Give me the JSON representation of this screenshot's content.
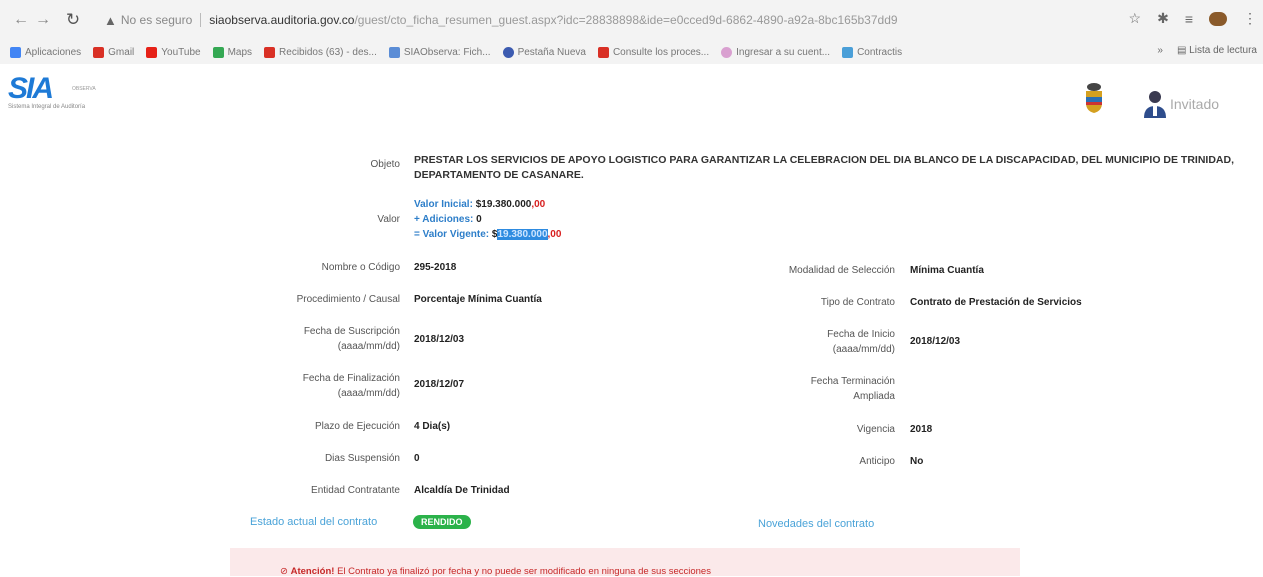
{
  "browser": {
    "secure_label": "No es seguro",
    "url_domain": "siaobserva.auditoria.gov.co",
    "url_path": "/guest/cto_ficha_resumen_guest.aspx?idc=28838898&ide=e0cced9d-6862-4890-a92a-8bc165b37dd9"
  },
  "bookmarks": [
    {
      "label": "Aplicaciones",
      "color": "#4285f4"
    },
    {
      "label": "Gmail",
      "color": "#d93025"
    },
    {
      "label": "YouTube",
      "color": "#e62117"
    },
    {
      "label": "Maps",
      "color": "#34a853"
    },
    {
      "label": "Recibidos (63) - des...",
      "color": "#d93025"
    },
    {
      "label": "SIAObserva: Fich...",
      "color": "#5b8dd6"
    },
    {
      "label": "Pestaña Nueva",
      "color": "#3c5bb0"
    },
    {
      "label": "Consulte los proces...",
      "color": "#d93025"
    },
    {
      "label": "Ingresar a su cuent...",
      "color": "#d9a0d0"
    },
    {
      "label": "Contractis",
      "color": "#4a9fd8"
    }
  ],
  "bookmarks_right": {
    "more": "»",
    "reading_list": "Lista de lectura"
  },
  "header": {
    "logo": "SIA",
    "logo_tag": "OBSERVA",
    "logo_sub": "Sistema Integral de Auditoría",
    "user_label": "Invitado"
  },
  "contract": {
    "objeto_label": "Objeto",
    "objeto": "PRESTAR LOS SERVICIOS DE APOYO LOGISTICO PARA GARANTIZAR LA CELEBRACION DEL DIA BLANCO DE LA DISCAPACIDAD, DEL MUNICIPIO DE TRINIDAD, DEPARTAMENTO DE CASANARE.",
    "valor_label": "Valor",
    "valor_inicial_label": "Valor Inicial:",
    "valor_inicial": "$19.380.000",
    "valor_inicial_cents": ",00",
    "adiciones_label": "+ Adiciones:",
    "adiciones": "0",
    "valor_vigente_label": "= Valor Vigente:",
    "valor_vigente_prefix": "$",
    "valor_vigente": "19.380.000",
    "valor_vigente_cents": ",00",
    "nombre_label": "Nombre o Código",
    "nombre": "295-2018",
    "modalidad_label": "Modalidad de Selección",
    "modalidad": "Mínima Cuantía",
    "procedimiento_label": "Procedimiento / Causal",
    "procedimiento": "Porcentaje Mínima Cuantía",
    "tipo_label": "Tipo de Contrato",
    "tipo": "Contrato de Prestación de Servicios",
    "fecha_suscripcion_label1": "Fecha de Suscripción",
    "fecha_suscripcion_label2": "(aaaa/mm/dd)",
    "fecha_suscripcion": "2018/12/03",
    "fecha_inicio_label1": "Fecha de Inicio",
    "fecha_inicio_label2": "(aaaa/mm/dd)",
    "fecha_inicio": "2018/12/03",
    "fecha_finalizacion_label1": "Fecha de Finalización",
    "fecha_finalizacion_label2": "(aaaa/mm/dd)",
    "fecha_finalizacion": "2018/12/07",
    "fecha_terminacion_label1": "Fecha Terminación",
    "fecha_terminacion_label2": "Ampliada",
    "plazo_label": "Plazo de Ejecución",
    "plazo": "4 Dia(s)",
    "vigencia_label": "Vigencia",
    "vigencia": "2018",
    "dias_suspension_label": "Dias Suspensión",
    "dias_suspension": "0",
    "anticipo_label": "Anticipo",
    "anticipo": "No",
    "entidad_label": "Entidad Contratante",
    "entidad": "Alcaldía De Trinidad",
    "estado_link": "Estado actual del contrato",
    "estado_badge": "RENDIDO",
    "novedades_link": "Novedades del contrato"
  },
  "alert": {
    "prefix": "Atención!",
    "text": "El Contrato ya finalizó por fecha y no puede ser modificado en ninguna de sus secciones"
  },
  "colors": {
    "accent_blue": "#2d7ec9",
    "badge_green": "#2bb24a",
    "alert_red": "#c62828"
  }
}
